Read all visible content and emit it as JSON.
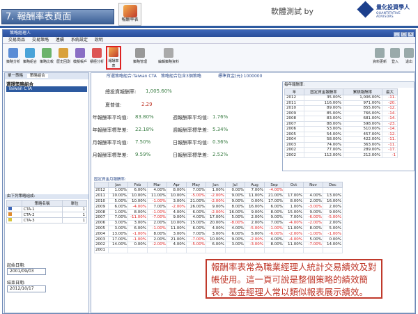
{
  "slide": {
    "title": "7. 報酬率表頁面",
    "icon_label": "報酬率表",
    "right_text": "軟體測試 by",
    "logo_cn": "量化投資學人",
    "logo_en": "QUANTITATIVE ADVISORS"
  },
  "window": {
    "title": "策略經理人"
  },
  "menu": [
    "交易商品",
    "交易策略",
    "連續",
    "系統設定",
    "說明"
  ],
  "toolbar": {
    "items": [
      "策略分析",
      "策略組合",
      "策略比較",
      "歷史回測",
      "模擬帳戶",
      "積極分析",
      "報酬率表",
      "策略管理",
      "編輯策略資料"
    ],
    "right": [
      "資料更新",
      "登入",
      "退出"
    ]
  },
  "left": {
    "tabs": [
      "單一策略",
      "策略組合"
    ],
    "tree_title": "選擇策略組合",
    "tree_item": "Taiwan CTA",
    "sub_title": "由下列策略組成:",
    "cols": [
      "策略名稱",
      "單位"
    ],
    "rows": [
      {
        "name": "CTA-1",
        "unit": "1",
        "color": "#3d66b8"
      },
      {
        "name": "CTA-2",
        "unit": "1",
        "color": "#e08a2e"
      },
      {
        "name": "CTA-3",
        "unit": "1",
        "color": "#d6c43b"
      }
    ],
    "start_label": "起始日期:",
    "start_date": "2001/09/03",
    "end_label": "結束日期:",
    "end_date": "2012/10/17"
  },
  "info": {
    "portfolio": "所選策略組合:Taiwan CTA",
    "count": "策略組合包含3個策略",
    "capital": "標準資金(元):1000000"
  },
  "metrics": {
    "total_label": "總投資報酬率:",
    "total": "1,005.60%",
    "sharpe_label": "夏普值:",
    "sharpe": "2.29",
    "y_avg_label": "年報酬率平均值:",
    "y_avg": "83.80%",
    "w_avg_label": "週報酬率平均值:",
    "w_avg": "1.76%",
    "y_std_label": "年報酬率標準差:",
    "y_std": "22.18%",
    "w_std_label": "週報酬率標準差:",
    "w_std": "5.34%",
    "m_avg_label": "月報酬率平均值:",
    "m_avg": "7.50%",
    "d_avg_label": "日報酬率平均值:",
    "d_avg": "0.36%",
    "m_std_label": "月報酬率標準差:",
    "m_std": "9.59%",
    "d_std_label": "日報酬率標準差:",
    "d_std": "2.52%"
  },
  "yearly": {
    "title": "每年報酬率:",
    "cols": [
      "年",
      "固定資金報酬率",
      "累積報酬率",
      "最大"
    ],
    "rows": [
      [
        "2012",
        "35.00%",
        "1,006.00%",
        "-11."
      ],
      [
        "2011",
        "116.00%",
        "971.00%",
        "-20."
      ],
      [
        "2010",
        "89.00%",
        "855.00%",
        "-12."
      ],
      [
        "2009",
        "85.00%",
        "766.00%",
        "-14."
      ],
      [
        "2008",
        "83.00%",
        "681.00%",
        "-14."
      ],
      [
        "2007",
        "88.00%",
        "598.00%",
        "-23."
      ],
      [
        "2006",
        "53.00%",
        "510.00%",
        "-14."
      ],
      [
        "2005",
        "54.00%",
        "457.00%",
        "-12."
      ],
      [
        "2004",
        "58.00%",
        "422.00%",
        "-11."
      ],
      [
        "2003",
        "74.00%",
        "363.00%",
        "-11."
      ],
      [
        "2002",
        "77.00%",
        "289.00%",
        "-17."
      ],
      [
        "2002",
        "112.00%",
        "212.00%",
        "-1"
      ]
    ]
  },
  "monthly": {
    "title": "固定資金月報酬率:",
    "cols": [
      "",
      "Jan",
      "Feb",
      "Mar",
      "Apr",
      "May",
      "Jun",
      "Jul",
      "Aug",
      "Sep",
      "Oct",
      "Nov",
      "Dec"
    ],
    "rows": [
      [
        "2012",
        "1.00%",
        "6.00%",
        "4.00%",
        "8.00%",
        "7.00%",
        "1.00%",
        "0.00%",
        "7.00%",
        "-4.00%",
        "",
        "",
        ""
      ],
      [
        "2011",
        "10.00%",
        "10.00%",
        "11.00%",
        "10.00%",
        "-5.00%",
        "-2.00%",
        "9.00%",
        "11.00%",
        "21.00%",
        "17.00%",
        "4.00%",
        "13.00%"
      ],
      [
        "2010",
        "5.00%",
        "10.00%",
        "-1.00%",
        "3.00%",
        "21.00%",
        "-2.00%",
        "9.00%",
        "0.00%",
        "17.00%",
        "8.00%",
        "2.00%",
        "16.00%"
      ],
      [
        "2009",
        "6.00%",
        "-4.00%",
        "7.00%",
        "-2.00%",
        "26.00%",
        "9.00%",
        "8.00%",
        "16.00%",
        "6.00%",
        "1.00%",
        "-3.00%",
        "2.00%"
      ],
      [
        "2008",
        "1.00%",
        "8.00%",
        "-1.00%",
        "4.00%",
        "6.00%",
        "-2.00%",
        "16.00%",
        "9.00%",
        "8.00%",
        "15.00%",
        "9.00%",
        "9.00%"
      ],
      [
        "2007",
        "7.00%",
        "-11.00%",
        "-7.00%",
        "9.00%",
        "4.00%",
        "17.00%",
        "5.00%",
        "2.00%",
        "9.00%",
        "7.00%",
        "-6.00%",
        "-5.00%"
      ],
      [
        "2006",
        "3.00%",
        "3.00%",
        "2.00%",
        "10.00%",
        "15.00%",
        "20.00%",
        "-8.00%",
        "2.00%",
        "7.00%",
        "-4.00%",
        "-2.00%",
        "2.00%"
      ],
      [
        "2005",
        "3.00%",
        "6.00%",
        "-1.00%",
        "11.00%",
        "6.00%",
        "4.00%",
        "4.00%",
        "-5.00%",
        "-1.00%",
        "11.00%",
        "8.00%",
        "5.00%"
      ],
      [
        "2004",
        "13.00%",
        "-1.00%",
        "8.00%",
        "3.00%",
        "7.00%",
        "3.00%",
        "6.00%",
        "5.00%",
        "-6.00%",
        "-2.00%",
        "-1.00%",
        "-1.00%"
      ],
      [
        "2003",
        "17.00%",
        "-1.00%",
        "2.00%",
        "21.00%",
        "-7.00%",
        "10.00%",
        "9.00%",
        "-2.00%",
        "4.00%",
        "-4.00%",
        "5.00%",
        "0.00%"
      ],
      [
        "2002",
        "14.00%",
        "0.00%",
        "-2.00%",
        "4.00%",
        "-5.00%",
        "6.00%",
        "3.00%",
        "-3.00%",
        "8.00%",
        "11.00%",
        "-7.00%",
        "14.00%"
      ],
      [
        "2001",
        "",
        "",
        "",
        "",
        "",
        "",
        "",
        "",
        "",
        "",
        "",
        ""
      ]
    ]
  },
  "callout": "報酬率表常為職業經理人統計交易績效及對帳使用。這一頁可說是整個策略的績效簡表，基金經理人常以類似報表展示績效。"
}
